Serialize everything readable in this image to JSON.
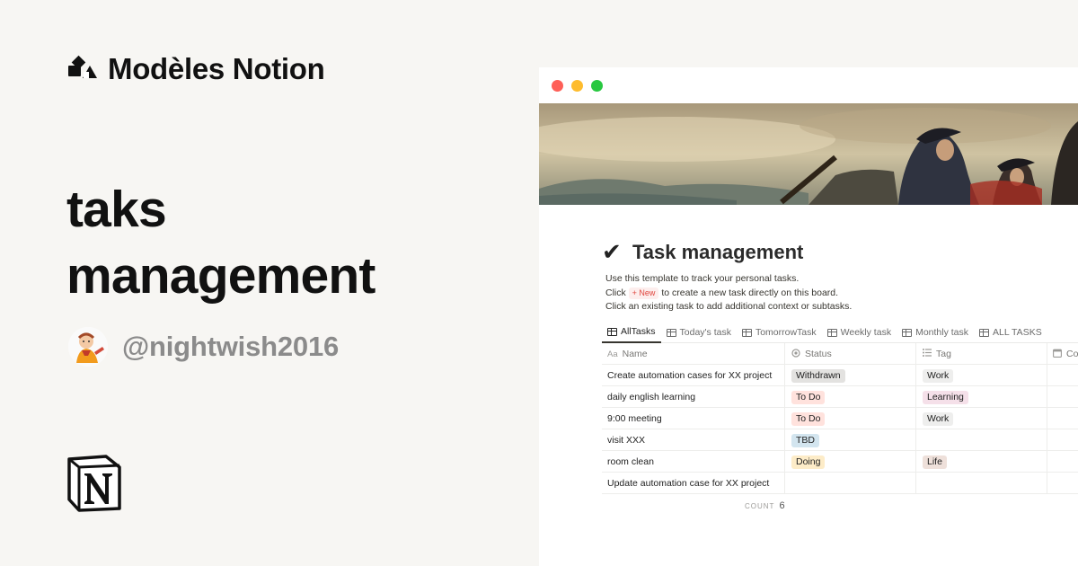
{
  "brand": {
    "name": "Modèles Notion",
    "logo_icon": "notion-shapes-logo-icon"
  },
  "template": {
    "title_line1": "taks",
    "title_line2": "management",
    "author_handle": "@nightwish2016",
    "avatar_icon": "cartoon-avatar-icon",
    "footer_logo": "notion-logo-icon"
  },
  "window": {
    "traffic_lights": {
      "close": "#fe5f57",
      "minimize": "#febc2e",
      "maximize": "#28c840"
    },
    "cover_icon": "painting-cover-image",
    "page": {
      "icon": "✔",
      "title": "Task management",
      "desc_line1": "Use this template to track your personal tasks.",
      "desc_line2_pre": "Click",
      "desc_line2_chip": "+ New",
      "desc_line2_post": "to create a new task directly on this board.",
      "desc_line3": "Click an existing task to add additional context or subtasks."
    },
    "tabs": [
      {
        "label": "AllTasks",
        "active": true
      },
      {
        "label": "Today's task"
      },
      {
        "label": "TomorrowTask"
      },
      {
        "label": "Weekly task"
      },
      {
        "label": "Monthly task"
      },
      {
        "label": "ALL TASKS"
      }
    ],
    "table": {
      "headers": {
        "name": "Name",
        "name_icon": "Aa",
        "status": "Status",
        "status_icon": "status-icon",
        "tag": "Tag",
        "tag_icon": "list-icon",
        "extra": "Co",
        "extra_icon": "calendar-icon"
      },
      "rows": [
        {
          "name": "Create automation cases for XX project",
          "status": "Withdrawn",
          "tag": "Work"
        },
        {
          "name": "daily english learning",
          "status": "To Do",
          "tag": "Learning"
        },
        {
          "name": "9:00 meeting",
          "status": "To Do",
          "tag": "Work"
        },
        {
          "name": "visit XXX",
          "status": "TBD",
          "tag": ""
        },
        {
          "name": "room clean",
          "status": "Doing",
          "tag": "Life"
        },
        {
          "name": "Update automation case for XX project",
          "status": "",
          "tag": ""
        }
      ],
      "count_label": "COUNT",
      "count_value": "6"
    },
    "colors": {
      "Withdrawn": "#e3e2e0",
      "To Do": "#ffe2dd",
      "TBD": "#d3e5ef",
      "Doing": "#fdecc8",
      "Work": "#eeeeed",
      "Learning": "#f5e0e9",
      "Life": "#eee0da"
    }
  }
}
